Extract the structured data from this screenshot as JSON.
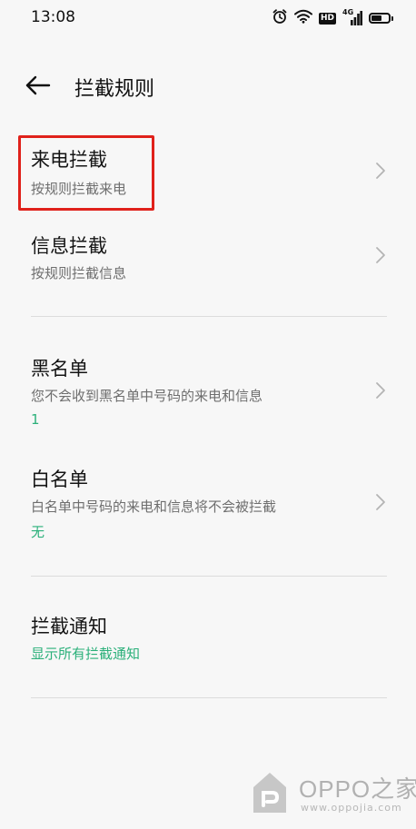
{
  "status_bar": {
    "time": "13:08",
    "hd": "HD",
    "network": "4G",
    "icons": [
      "alarm-icon",
      "wifi-icon",
      "hd-icon",
      "signal-4g-icon",
      "battery-icon"
    ]
  },
  "header": {
    "back_icon": "arrow-left-icon",
    "title": "拦截规则"
  },
  "items": [
    {
      "title": "来电拦截",
      "subtitle": "按规则拦截来电",
      "chevron": true,
      "highlighted": true
    },
    {
      "title": "信息拦截",
      "subtitle": "按规则拦截信息",
      "chevron": true
    },
    {
      "title": "黑名单",
      "subtitle": "您不会收到黑名单中号码的来电和信息",
      "value": "1",
      "chevron": true
    },
    {
      "title": "白名单",
      "subtitle": "白名单中号码的来电和信息将不会被拦截",
      "value": "无",
      "chevron": true
    },
    {
      "title": "拦截通知",
      "value": "显示所有拦截通知",
      "chevron": false
    }
  ],
  "colors": {
    "accent_green": "#2bb07a",
    "highlight_red": "#e0211b",
    "background": "#f7f7f7"
  },
  "watermark": {
    "text": "OPPO之家",
    "url": "www.oppojia.com"
  }
}
